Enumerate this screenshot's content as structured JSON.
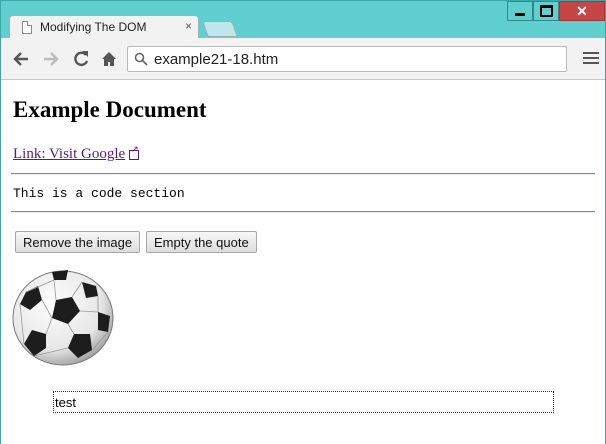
{
  "window": {
    "tab_title": "Modifying The DOM",
    "tab_close": "×",
    "controls": {
      "minimize": "minimize-icon",
      "maximize": "maximize-icon",
      "close": "close-icon"
    },
    "close_color": "#c74545"
  },
  "toolbar": {
    "url": "example21-18.htm",
    "icons": [
      "back-icon",
      "forward-icon",
      "reload-icon",
      "home-icon",
      "search-icon",
      "menu-icon"
    ]
  },
  "page": {
    "heading": "Example Document",
    "link_text": "Link: Visit Google",
    "code_text": "This is a code section",
    "buttons": {
      "remove_image": "Remove the image",
      "empty_quote": "Empty the quote"
    },
    "quote_text": "test",
    "link_color": "#551a8b"
  }
}
